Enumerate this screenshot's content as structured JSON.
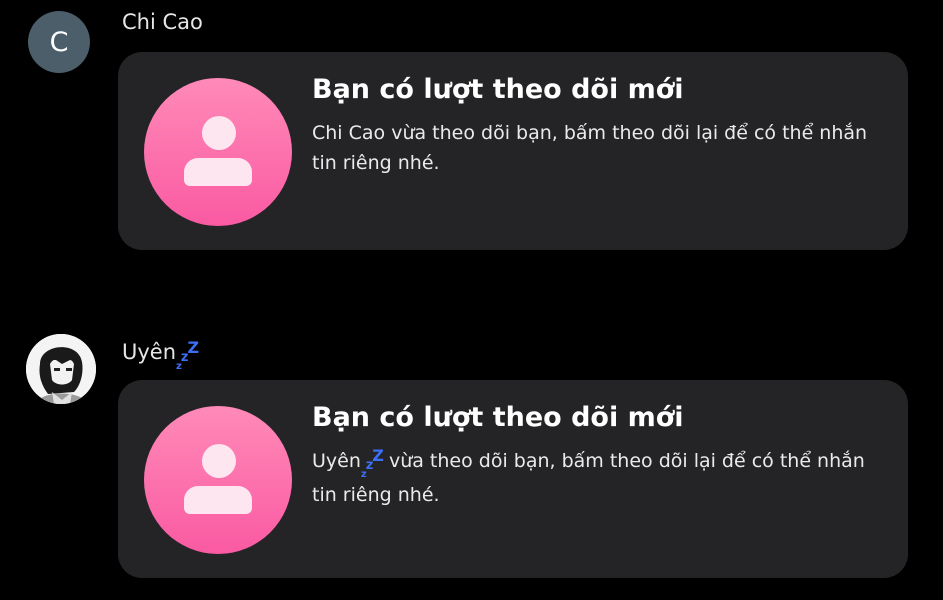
{
  "messages": [
    {
      "sender": "Chi Cao",
      "avatar_letter": "C",
      "card_title": "Bạn có lượt theo dõi mới",
      "card_text": "Chi Cao vừa theo dõi bạn, bấm theo dõi lại để có thể nhắn tin riêng nhé."
    },
    {
      "sender": "Uyên",
      "sender_suffix": "zzZ",
      "card_title": "Bạn có lượt theo dõi mới",
      "card_text_name": "Uyên",
      "card_text_rest": "vừa theo dõi bạn, bấm theo dõi lại để có thể nhắn tin riêng nhé."
    }
  ],
  "icons": {
    "card_icon": "user-icon",
    "sleep_badge": "zzz-icon"
  },
  "colors": {
    "background": "#000000",
    "card": "#242426",
    "avatar_letter_bg": "#4b5e6a",
    "icon_pink_top": "#ff8ab8",
    "icon_pink_bottom": "#fa5aa2",
    "zzz": "#3b6ff5"
  }
}
